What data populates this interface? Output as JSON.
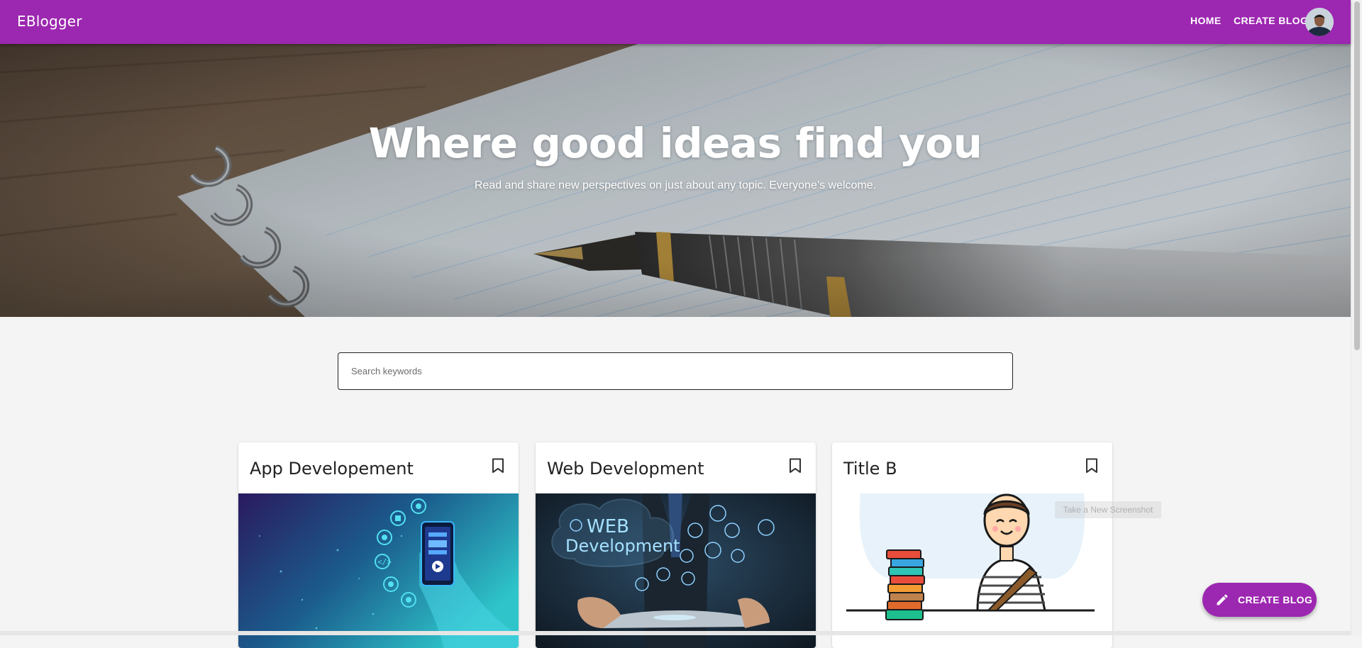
{
  "appbar": {
    "brand": "EBlogger",
    "nav": {
      "home": "HOME",
      "create_blog": "CREATE BLOG"
    },
    "background": "#9c27b0"
  },
  "hero": {
    "title": "Where good ideas find you",
    "subtitle": "Read and share new perspectives on just about any topic. Everyone’s welcome."
  },
  "search": {
    "placeholder": "Search keywords",
    "value": ""
  },
  "cards": [
    {
      "title": "App Developement",
      "icon": "bookmark-border-icon",
      "image": "app-development-illustration"
    },
    {
      "title": "Web Development",
      "icon": "bookmark-border-icon",
      "image": "web-development-illustration"
    },
    {
      "title": "Title B",
      "icon": "bookmark-border-icon",
      "image": "student-with-books-illustration"
    }
  ],
  "tooltip": {
    "text": "Take a New Screenshot"
  },
  "fab": {
    "label": "CREATE BLOG",
    "icon": "pencil-icon",
    "background": "#9c27b0"
  }
}
